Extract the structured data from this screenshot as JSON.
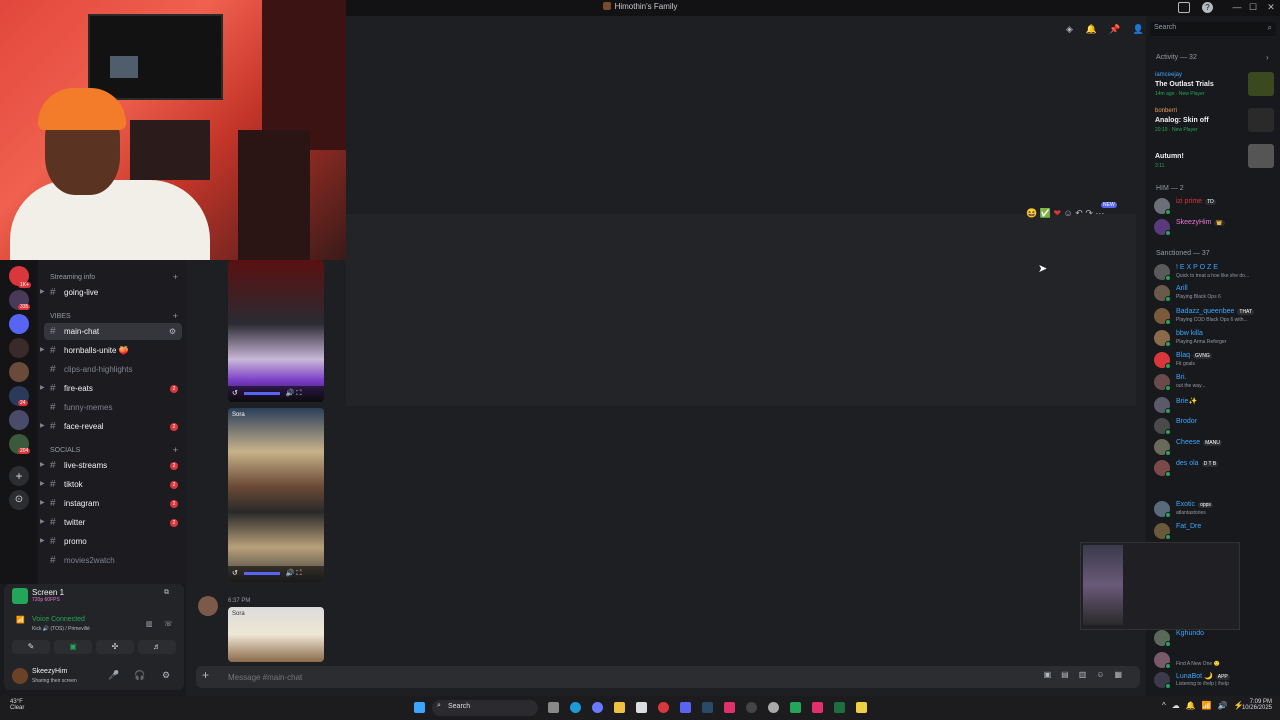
{
  "window": {
    "title": "Himothin's Family",
    "controls": [
      "—",
      "☐",
      "✕"
    ]
  },
  "channels": {
    "categories": [
      {
        "label": "Streaming info"
      },
      {
        "label": "VIBES"
      },
      {
        "label": "SOCIALS"
      }
    ],
    "items": [
      {
        "name": "going-live",
        "muted": false,
        "badge": ""
      },
      {
        "name": "main-chat",
        "muted": false,
        "badge": ""
      },
      {
        "name": "hornballs-unite 🍑",
        "muted": false,
        "badge": ""
      },
      {
        "name": "clips-and-highlights",
        "muted": true,
        "badge": ""
      },
      {
        "name": "fire-eats",
        "muted": false,
        "badge": "2"
      },
      {
        "name": "funny-memes",
        "muted": true,
        "badge": ""
      },
      {
        "name": "face-reveal",
        "muted": false,
        "badge": "2"
      },
      {
        "name": "live-streams",
        "muted": false,
        "badge": "2"
      },
      {
        "name": "tiktok",
        "muted": false,
        "badge": "2"
      },
      {
        "name": "instagram",
        "muted": false,
        "badge": "2"
      },
      {
        "name": "twitter",
        "muted": false,
        "badge": "2"
      },
      {
        "name": "promo",
        "muted": false,
        "badge": ""
      },
      {
        "name": "movies2watch",
        "muted": true,
        "badge": ""
      }
    ]
  },
  "servers": {
    "badges": [
      "1K+",
      "335",
      "24",
      "204"
    ]
  },
  "voice": {
    "screen_title": "Screen 1",
    "screen_sub": "720p 60FPS",
    "status": "Voice Connected",
    "location": "Kick 🔊 (TOS) / Primevillé"
  },
  "user": {
    "name": "SkeezyHim",
    "status": "Sharing their screen"
  },
  "chat": {
    "placeholder": "Message #main-chat",
    "message_time": "6:37 PM",
    "new_tag": "NEW",
    "sora_label": "Sora"
  },
  "search": {
    "placeholder": "Search"
  },
  "members": {
    "activity_header": "Activity — 32",
    "activities": [
      {
        "user": "iamceejay",
        "game": "The Outlast Trials",
        "meta": "14m ago · New Player",
        "art_color": "#3b4a1e"
      },
      {
        "user": "bonberri",
        "game": "Analog: Skin off",
        "meta": "20:19 · New Player",
        "art_color": "#2a2a2a"
      },
      {
        "user": "",
        "game": "Autumn!",
        "meta": "3:11",
        "art_color": "#555"
      }
    ],
    "him_header": "HIM — 2",
    "him": [
      {
        "name": "izi prime",
        "tag": "TD",
        "sub": "",
        "color": "#da373c"
      },
      {
        "name": "SkeezyHim",
        "tag": "👑",
        "sub": "",
        "color": "#e67ad7"
      }
    ],
    "sanctioned_header": "Sanctioned — 37",
    "sanctioned": [
      {
        "name": "! E X P O Z E",
        "tag": "",
        "sub": "Quick to treat a hoe like she do...",
        "color": "#3ba5ff"
      },
      {
        "name": "Arill",
        "tag": "",
        "sub": "Playing Black Ops 6",
        "color": "#3ba5ff"
      },
      {
        "name": "Badazz_queenbee",
        "tag": "THAT",
        "sub": "Playing COD Black Ops 6 with...",
        "color": "#3ba5ff"
      },
      {
        "name": "bbw killa",
        "tag": "",
        "sub": "Playing Arma Reforger",
        "color": "#3ba5ff"
      },
      {
        "name": "Blaq",
        "tag": "GVNG",
        "sub": "Fit goals",
        "color": "#3ba5ff"
      },
      {
        "name": "Bri.",
        "tag": "",
        "sub": "out the way...",
        "color": "#3ba5ff"
      },
      {
        "name": "Brie✨",
        "tag": "",
        "sub": "",
        "color": "#3ba5ff"
      },
      {
        "name": "Brodor",
        "tag": "",
        "sub": "",
        "color": "#3ba5ff"
      },
      {
        "name": "Cheese",
        "tag": "MANU",
        "sub": "",
        "color": "#3ba5ff"
      },
      {
        "name": "des ola",
        "tag": "D T B",
        "sub": "",
        "color": "#3ba5ff"
      },
      {
        "name": "Exotic",
        "tag": "opps",
        "sub": "atlantastories",
        "color": "#3ba5ff"
      },
      {
        "name": "Fat_Dre",
        "tag": "",
        "sub": "",
        "color": "#3ba5ff"
      },
      {
        "name": "Kghundo",
        "tag": "",
        "sub": "",
        "color": "#3ba5ff"
      },
      {
        "name": "",
        "tag": "",
        "sub": "Find A New One 🙂",
        "color": "#da373c"
      },
      {
        "name": "LunaBot 🌙",
        "tag": "APP",
        "sub": "Listening to /help | /help",
        "color": "#3ba5ff"
      }
    ]
  },
  "taskbar": {
    "weather_temp": "43°F",
    "weather_desc": "Clear",
    "search_label": "Search",
    "time": "7:09 PM",
    "date": "10/26/2025"
  },
  "colors": {
    "accent": "#5865f2",
    "online": "#23a55a",
    "danger": "#da373c"
  }
}
